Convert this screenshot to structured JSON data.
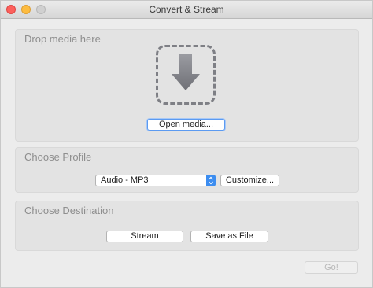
{
  "window": {
    "title": "Convert & Stream"
  },
  "drop_section": {
    "heading": "Drop media here",
    "drop_icon": "download-arrow-icon",
    "open_button": "Open media..."
  },
  "profile_section": {
    "heading": "Choose Profile",
    "selected_profile": "Audio - MP3",
    "customize_button": "Customize..."
  },
  "destination_section": {
    "heading": "Choose Destination",
    "stream_button": "Stream",
    "save_button": "Save as File"
  },
  "footer": {
    "go_button": "Go!"
  },
  "colors": {
    "accent": "#3c8df0",
    "close": "#fc605c",
    "minimize": "#fdbc40",
    "drop_icon": "#7e7f85"
  }
}
